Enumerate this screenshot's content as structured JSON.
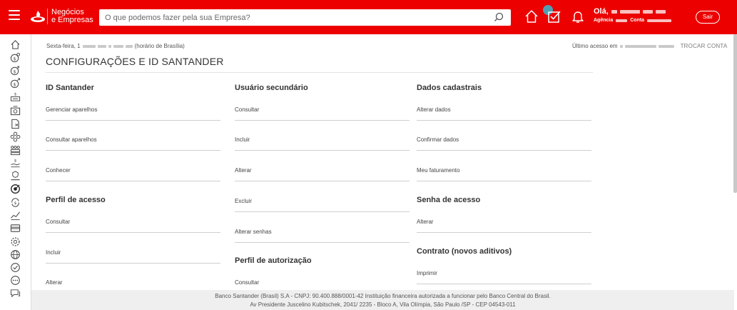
{
  "header": {
    "brand_line1": "Negócios",
    "brand_line2": "e Empresas",
    "search_placeholder": "O que podemos fazer pela sua Empresa?",
    "greeting": "Olá,",
    "agencia_label": "Agência",
    "conta_label": "Conta",
    "logout_label": "Sair",
    "colors": {
      "header_bg": "#ec0000",
      "notif_dot": "#4e9fb4"
    },
    "icons": [
      "menu-icon",
      "santander-flame-icon",
      "search-icon",
      "home-icon",
      "checklist-icon",
      "bell-icon"
    ]
  },
  "sidebar": {
    "icons": [
      "home-icon",
      "money-icon",
      "money-plus-icon",
      "money-arrow-icon",
      "money-transfer-icon",
      "cash-box-icon",
      "document-icon",
      "network-icon",
      "people-icon",
      "money-hand-icon",
      "hand-shield-icon",
      "target-icon",
      "cycle-icon",
      "growth-icon",
      "card-icon",
      "settings-icon",
      "globe-icon",
      "check-circle-icon",
      "more-icon",
      "chat-icon"
    ]
  },
  "top": {
    "date_prefix": "Sexta-feira, 1",
    "timezone": "(horário de Brasília)",
    "last_access_label": "Último acesso em",
    "switch_account": "TROCAR CONTA"
  },
  "page_title": "CONFIGURAÇÕES E ID SANTANDER",
  "columns": [
    {
      "sections": [
        {
          "title": "ID Santander",
          "items": [
            "Gerenciar aparelhos",
            "Consultar aparelhos",
            "Conhecer"
          ]
        },
        {
          "title": "Perfil de acesso",
          "items": [
            "Consultar",
            "Incluir",
            "Alterar"
          ]
        }
      ]
    },
    {
      "sections": [
        {
          "title": "Usuário secundário",
          "items": [
            "Consultar",
            "Incluir",
            "Alterar",
            "Excluir",
            "Alterar senhas"
          ]
        },
        {
          "title": "Perfil de autorização",
          "items": [
            "Consultar"
          ]
        }
      ]
    },
    {
      "sections": [
        {
          "title": "Dados cadastrais",
          "items": [
            "Alterar dados",
            "Confirmar dados",
            "Meu faturamento"
          ]
        },
        {
          "title": "Senha de acesso",
          "items": [
            "Alterar"
          ]
        },
        {
          "title": "Contrato (novos aditivos)",
          "items": [
            "Imprimir"
          ]
        }
      ]
    }
  ],
  "footer": {
    "line1": "Banco Santander (Brasil) S.A - CNPJ: 90.400.888/0001-42 Instituição financeira autorizada a funcionar pelo Banco Central do Brasil.",
    "line2": "Av Presidente Juscelino Kubitschek, 2041/ 2235 - Bloco A, Vila Olímpia, São Paulo /SP - CEP 04543-011"
  }
}
